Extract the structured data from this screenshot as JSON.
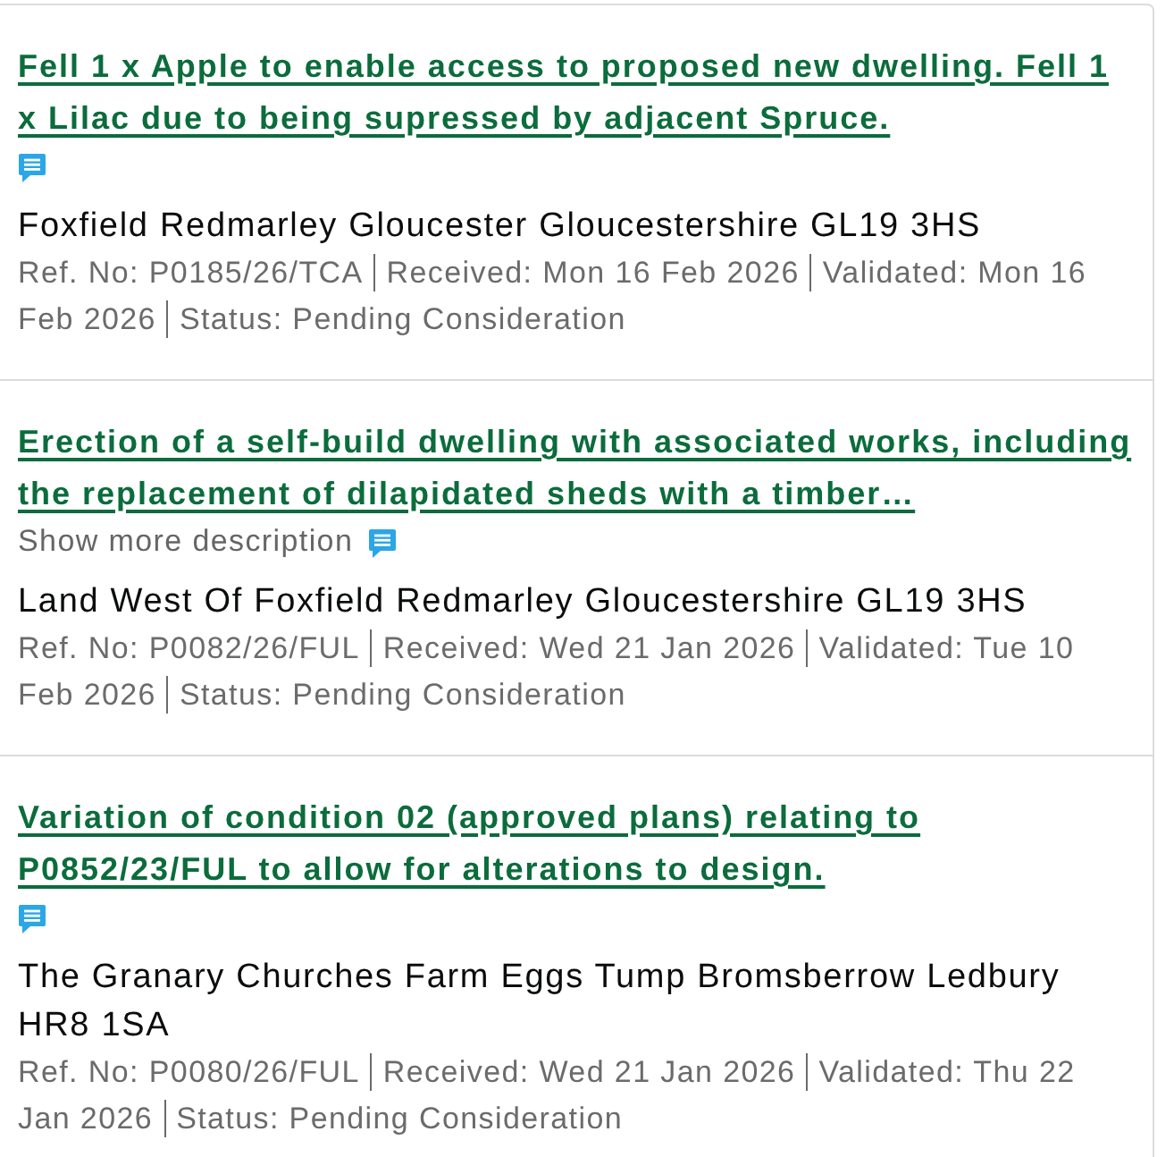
{
  "applications": [
    {
      "title": "Fell 1 x Apple to enable access to proposed new dwelling. Fell 1 x Lilac due to being supressed by adjacent Spruce.",
      "address": "Foxfield Redmarley Gloucester Gloucestershire GL19 3HS",
      "details": [
        "Ref. No: P0185/26/TCA",
        "Received: Mon 16 Feb 2026",
        "Validated: Mon 16 Feb 2026",
        "Status: Pending Consideration"
      ]
    },
    {
      "title": "Erection of a self-build dwelling with associated works, including the replacement of dilapidated sheds with a timber…",
      "show_more": "Show more description",
      "address": "Land West Of Foxfield Redmarley Gloucestershire GL19 3HS",
      "details": [
        "Ref. No: P0082/26/FUL",
        "Received: Wed 21 Jan 2026",
        "Validated: Tue 10 Feb 2026",
        "Status: Pending Consideration"
      ]
    },
    {
      "title": "Variation of condition 02 (approved plans) relating to P0852/23/FUL to allow for alterations to design.",
      "address": "The Granary Churches Farm Eggs Tump Bromsberrow Ledbury HR8 1SA",
      "details": [
        "Ref. No: P0080/26/FUL",
        "Received: Wed 21 Jan 2026",
        "Validated: Thu 22 Jan 2026",
        "Status: Pending Consideration"
      ]
    }
  ]
}
